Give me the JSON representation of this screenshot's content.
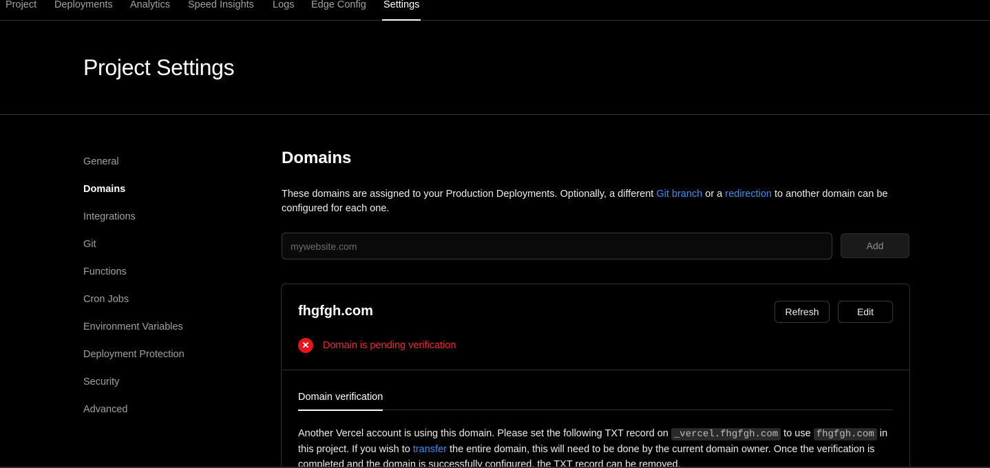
{
  "topnav": {
    "tabs": [
      {
        "label": "Project"
      },
      {
        "label": "Deployments"
      },
      {
        "label": "Analytics"
      },
      {
        "label": "Speed Insights"
      },
      {
        "label": "Logs"
      },
      {
        "label": "Edge Config"
      },
      {
        "label": "Settings",
        "active": true
      }
    ]
  },
  "header": {
    "title": "Project Settings"
  },
  "sidebar": {
    "items": [
      {
        "label": "General"
      },
      {
        "label": "Domains",
        "active": true
      },
      {
        "label": "Integrations"
      },
      {
        "label": "Git"
      },
      {
        "label": "Functions"
      },
      {
        "label": "Cron Jobs"
      },
      {
        "label": "Environment Variables"
      },
      {
        "label": "Deployment Protection"
      },
      {
        "label": "Security"
      },
      {
        "label": "Advanced"
      }
    ]
  },
  "domains": {
    "title": "Domains",
    "desc_part1": "These domains are assigned to your Production Deployments. Optionally, a different ",
    "git_branch_link": "Git branch",
    "desc_part2": " or a ",
    "redirection_link": "redirection",
    "desc_part3": " to another domain can be configured for each one.",
    "input_placeholder": "mywebsite.com",
    "add_label": "Add"
  },
  "domain_card": {
    "name": "fhgfgh.com",
    "refresh_label": "Refresh",
    "edit_label": "Edit",
    "status_icon": "x-circle-icon",
    "status_text": "Domain is pending verification",
    "status_color": "#e5151b",
    "subtab_label": "Domain verification",
    "verify_part1": "Another Vercel account is using this domain. Please set the following TXT record on ",
    "txt_host": "_vercel.fhgfgh.com",
    "verify_part2": " to use ",
    "domain_code": "fhgfgh.com",
    "verify_part3": " in this project. If you wish to ",
    "transfer_link": "transfer",
    "verify_part4": " the entire domain, this will need to be done by the current domain owner. Once the verification is completed and the domain is successfully configured, the TXT record can be removed."
  },
  "colors": {
    "accent_link": "#3b8ef7",
    "background": "#000000"
  }
}
